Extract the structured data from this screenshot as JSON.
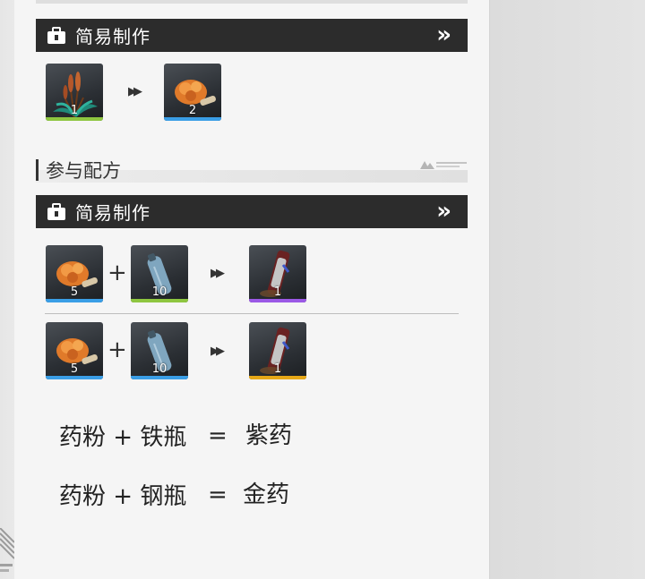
{
  "simple_craft_1": {
    "title": "简易制作",
    "chevron": "»"
  },
  "recipe_top": {
    "input": {
      "icon": "reed-plant-icon",
      "count": "1",
      "rarity_color": "#8ec640"
    },
    "output": {
      "icon": "orange-powder-icon",
      "count": "2",
      "rarity_color": "#3a9ee6"
    }
  },
  "section": {
    "title": "参与配方"
  },
  "simple_craft_2": {
    "title": "简易制作",
    "chevron": "»"
  },
  "recipes": [
    {
      "in1": {
        "icon": "orange-powder-icon",
        "count": "5",
        "rarity_color": "#3a9ee6"
      },
      "plus": "+",
      "in2": {
        "icon": "iron-bottle-icon",
        "count": "10",
        "rarity_color": "#8ec640"
      },
      "output": {
        "icon": "purple-potion-icon",
        "count": "1",
        "rarity_color": "#9b59e6"
      }
    },
    {
      "in1": {
        "icon": "orange-powder-icon",
        "count": "5",
        "rarity_color": "#3a9ee6"
      },
      "plus": "+",
      "in2": {
        "icon": "steel-bottle-icon",
        "count": "10",
        "rarity_color": "#3a9ee6"
      },
      "output": {
        "icon": "gold-potion-icon",
        "count": "1",
        "rarity_color": "#e6a817"
      }
    }
  ],
  "annotations": [
    {
      "left": "药粉 + 铁瓶",
      "eq": "=",
      "right": "紫药"
    },
    {
      "left": "药粉 + 钢瓶",
      "eq": "=",
      "right": "金药"
    }
  ]
}
